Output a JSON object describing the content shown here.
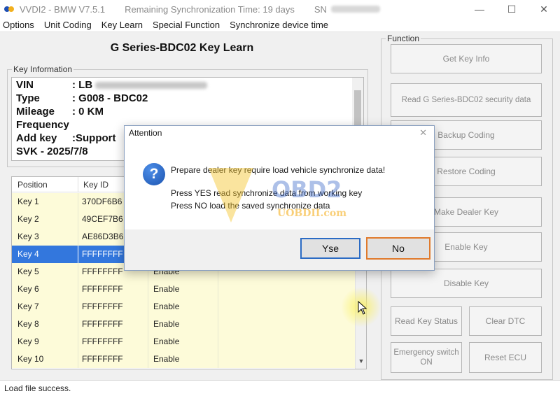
{
  "window": {
    "title": "VVDI2 - BMW V7.5.1",
    "sync_status": "Remaining Synchronization Time: 19 days",
    "sn_label": "SN"
  },
  "menu": [
    "Options",
    "Unit Coding",
    "Key Learn",
    "Special Function",
    "Synchronize device time"
  ],
  "heading": "G Series-BDC02 Key Learn",
  "key_info": {
    "legend": "Key Information",
    "rows": [
      {
        "label": "VIN",
        "value": ": LB"
      },
      {
        "label": "Type",
        "value": ": G008 - BDC02"
      },
      {
        "label": "Mileage",
        "value": ": 0 KM"
      },
      {
        "label": "Frequency",
        "value": ""
      },
      {
        "label": "Add key",
        "value": ":Support"
      },
      {
        "label": "SVK - 2025/7/8",
        "value": ""
      }
    ]
  },
  "table": {
    "headers": [
      "Position",
      "Key ID"
    ],
    "rows": [
      {
        "pos": "Key 1",
        "id": "370DF6B6",
        "status": ""
      },
      {
        "pos": "Key 2",
        "id": "49CEF7B6",
        "status": ""
      },
      {
        "pos": "Key 3",
        "id": "AE86D3B6",
        "status": ""
      },
      {
        "pos": "Key 4",
        "id": "FFFFFFFF",
        "status": ""
      },
      {
        "pos": "Key 5",
        "id": "FFFFFFFF",
        "status": "Enable"
      },
      {
        "pos": "Key 6",
        "id": "FFFFFFFF",
        "status": "Enable"
      },
      {
        "pos": "Key 7",
        "id": "FFFFFFFF",
        "status": "Enable"
      },
      {
        "pos": "Key 8",
        "id": "FFFFFFFF",
        "status": "Enable"
      },
      {
        "pos": "Key 9",
        "id": "FFFFFFFF",
        "status": "Enable"
      },
      {
        "pos": "Key 10",
        "id": "FFFFFFFF",
        "status": "Enable"
      }
    ]
  },
  "function": {
    "legend": "Function",
    "get_key_info": "Get Key Info",
    "read_security": "Read G Series-BDC02 security data",
    "backup_coding": "Backup Coding",
    "restore_coding": "Restore Coding",
    "make_dealer_key": "Make Dealer Key",
    "enable_key": "Enable Key",
    "disable_key": "Disable Key",
    "read_key_status": "Read Key Status",
    "clear_dtc": "Clear DTC",
    "emergency_switch": "Emergency switch ON",
    "reset_ecu": "Reset ECU"
  },
  "status_bar": "Load file success.",
  "dialog": {
    "title": "Attention",
    "message": "Prepare dealer key require load vehicle synchronize data!",
    "line2": "Press YES read synchronize data from working key",
    "line3": "Press NO load the saved synchronize data",
    "yes_label": "Ysе",
    "no_label": "No"
  },
  "watermark": {
    "brand": "OBD2",
    "site": "UOBDII.com"
  },
  "colors": {
    "selection": "#3377dd",
    "row_bg": "#fdfbd9",
    "no_focus": "#e07a2c",
    "yes_border": "#2b6bc4"
  }
}
